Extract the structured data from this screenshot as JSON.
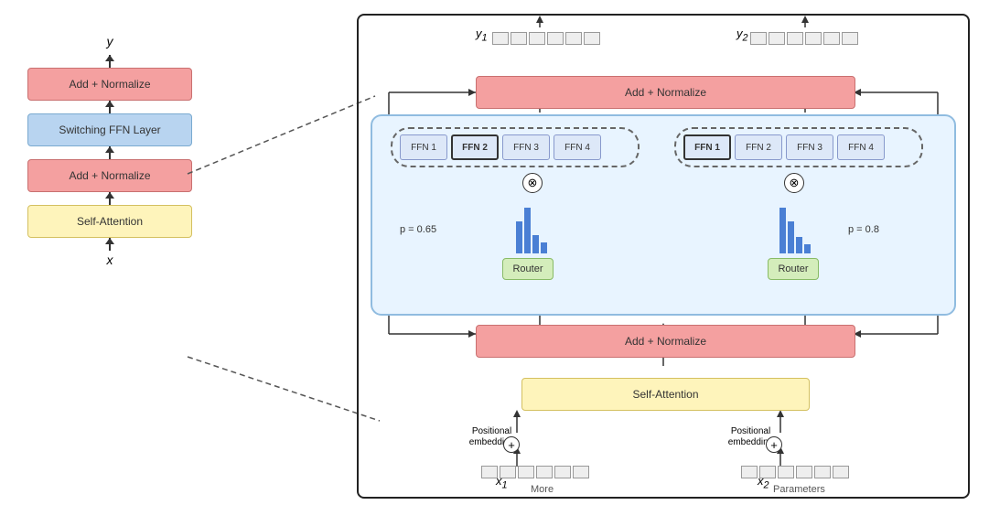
{
  "left": {
    "y_label": "y",
    "x_label": "x",
    "add_norm_1": "Add + Normalize",
    "add_norm_2": "Add + Normalize",
    "switch_ffn": "Switching FFN Layer",
    "self_attn": "Self-Attention"
  },
  "right": {
    "y1_label": "y",
    "y1_subscript": "1",
    "y2_label": "y",
    "y2_subscript": "2",
    "add_norm_top": "Add + Normalize",
    "add_norm_bottom": "Add + Normalize",
    "self_attn": "Self-Attention",
    "router1_label": "Router",
    "router2_label": "Router",
    "p1_label": "p = 0.65",
    "p2_label": "p = 0.8",
    "ffn_left": [
      "FFN 1",
      "FFN 2",
      "FFN 3",
      "FFN 4"
    ],
    "ffn_right": [
      "FFN 1",
      "FFN 2",
      "FFN 3",
      "FFN 4"
    ],
    "ffn_left_bold_index": 1,
    "ffn_right_bold_index": 0,
    "pos_emb_1": "Positional\nembedding",
    "pos_emb_2": "Positional\nembedding",
    "x1_label": "x",
    "x1_subscript": "1",
    "x2_label": "x",
    "x2_subscript": "2",
    "more_label": "More",
    "params_label": "Parameters"
  },
  "colors": {
    "pink": "#f4a0a0",
    "blue_light": "#b8d4f0",
    "yellow": "#fef4bb",
    "green_router": "#d4edbb",
    "blue_inner_bg": "#e8f4ff"
  }
}
